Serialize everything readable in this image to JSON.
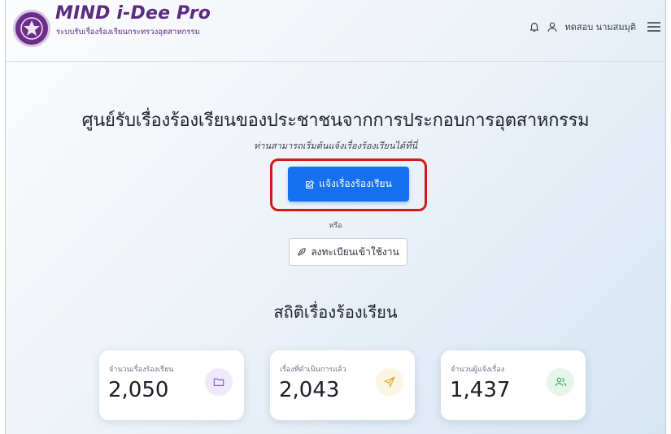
{
  "brand": {
    "title": "MIND i-Dee Pro",
    "subtitle": "ระบบรับเรื่องร้องเรียนกระทรวงอุตสาหกรรม",
    "logo_icon": "ministry-seal-icon"
  },
  "header": {
    "user_name": "ทดสอบ นามสมมุติ",
    "icons": [
      "bell-icon",
      "user-icon",
      "menu-icon"
    ]
  },
  "hero": {
    "title": "ศูนย์รับเรื่องร้องเรียนของประชาชนจากการประกอบการอุตสาหกรรม",
    "subtitle": "ท่านสามารถเริ่มต้นแจ้งเรื่องร้องเรียนได้ที่นี่",
    "cta_label": "แจ้งเรื่องร้องเรียน",
    "or_text": "หรือ",
    "register_label": "ลงทะเบียนเข้าใช้งาน"
  },
  "stats": {
    "title": "สถิติเรื่องร้องเรียน",
    "cards": [
      {
        "label": "จำนวนเรื่องร้องเรียน",
        "value": "2,050",
        "icon": "folder-icon",
        "color": "#7c5cd6",
        "bg": "#efeafb"
      },
      {
        "label": "เรื่องที่ดำเนินการแล้ว",
        "value": "2,043",
        "icon": "send-icon",
        "color": "#e0a92c",
        "bg": "#fdf5e3"
      },
      {
        "label": "จำนวนผู้แจ้งเรื่อง",
        "value": "1,437",
        "icon": "users-icon",
        "color": "#3aa35b",
        "bg": "#e6f5ea"
      }
    ]
  },
  "colors": {
    "brand_purple": "#5b2a82",
    "primary_blue": "#1571f0",
    "highlight_red": "#d11a1a"
  }
}
